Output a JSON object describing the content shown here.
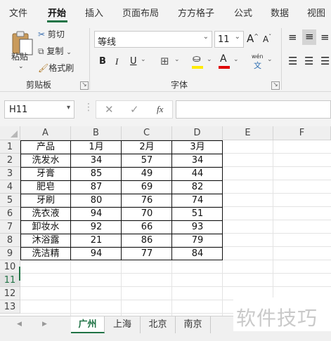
{
  "ribbon_tabs": [
    "文件",
    "开始",
    "插入",
    "页面布局",
    "方方格子",
    "公式",
    "数据",
    "视图"
  ],
  "clipboard": {
    "paste": "粘贴",
    "cut": "剪切",
    "copy": "复制",
    "format_painter": "格式刷",
    "group_label": "剪贴板"
  },
  "font": {
    "name": "等线",
    "size": "11",
    "group_label": "字体",
    "bold": "B",
    "italic": "I",
    "underline": "U",
    "grow": "A",
    "shrink": "A",
    "font_color": "A",
    "highlight_color": "#ffeb00",
    "text_color": "#e00000",
    "wen_top": "wén",
    "wen_bottom": "文"
  },
  "formula_bar": {
    "name_box": "H11",
    "fx": "fx",
    "formula": ""
  },
  "columns": [
    "A",
    "B",
    "C",
    "D",
    "E",
    "F"
  ],
  "rows": [
    "1",
    "2",
    "3",
    "4",
    "5",
    "6",
    "7",
    "8",
    "9",
    "10",
    "11",
    "12",
    "13"
  ],
  "table": {
    "header": [
      "产品",
      "1月",
      "2月",
      "3月"
    ],
    "rows": [
      [
        "洗发水",
        "34",
        "57",
        "34"
      ],
      [
        "牙膏",
        "85",
        "49",
        "44"
      ],
      [
        "肥皂",
        "87",
        "69",
        "82"
      ],
      [
        "牙刷",
        "80",
        "76",
        "74"
      ],
      [
        "洗衣液",
        "94",
        "70",
        "51"
      ],
      [
        "卸妆水",
        "92",
        "66",
        "93"
      ],
      [
        "沐浴露",
        "21",
        "86",
        "79"
      ],
      [
        "洗洁精",
        "94",
        "77",
        "84"
      ]
    ]
  },
  "sheet_tabs": [
    "广州",
    "上海",
    "北京",
    "南京"
  ],
  "active_sheet": "广州",
  "watermark": "软件技巧",
  "accent_color": "#217346"
}
